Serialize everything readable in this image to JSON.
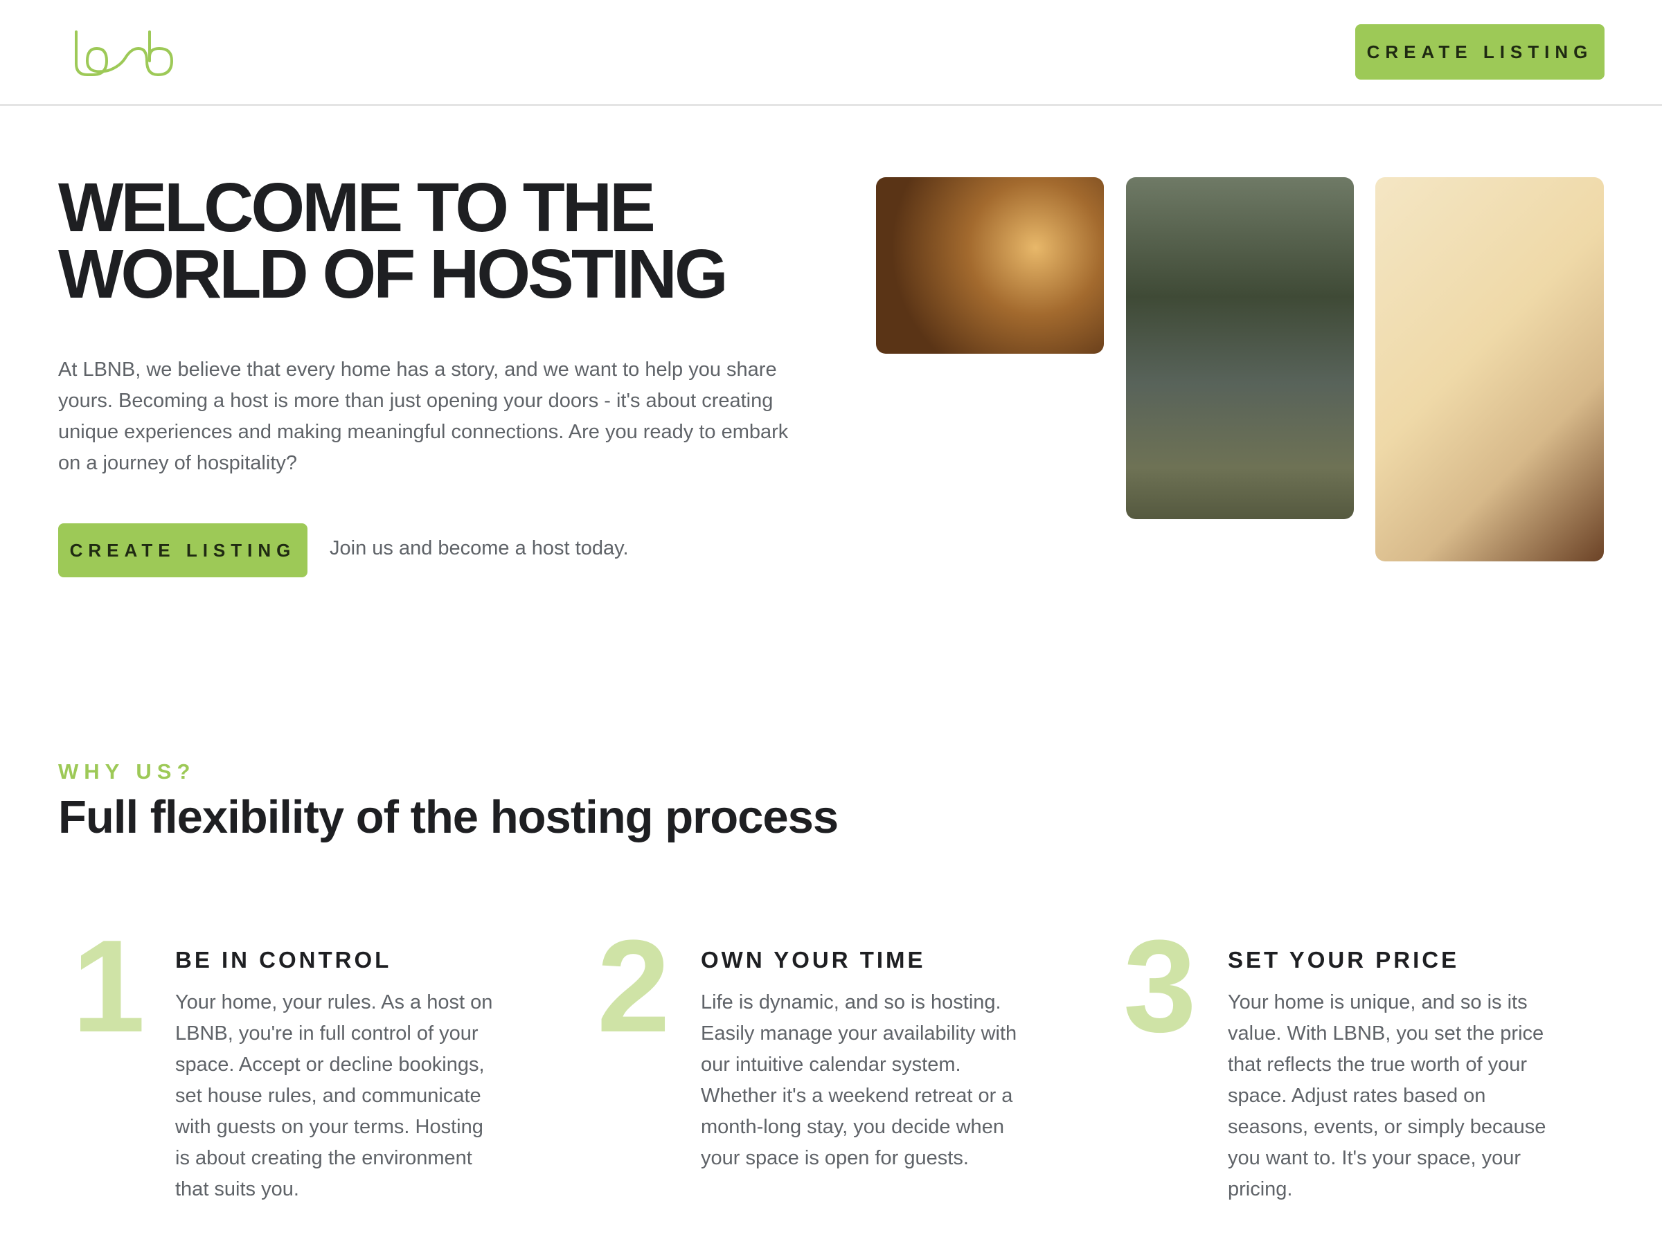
{
  "header": {
    "logo_text": "lbnb",
    "create_listing_label": "CREATE LISTING"
  },
  "hero": {
    "title_line1": "WELCOME TO THE",
    "title_line2": "WORLD OF HOSTING",
    "intro": "At LBNB, we believe that every home has a story, and we want to help you share yours. Becoming a host is more than just opening your doors - it's about creating unique experiences and making meaningful connections. Are you ready to embark on a journey of hospitality?",
    "cta_label": "CREATE LISTING",
    "cta_note": "Join us and become a host today."
  },
  "why": {
    "eyebrow": "WHY US?",
    "title": "Full flexibility of the hosting process",
    "features": [
      {
        "number": "1",
        "title": "BE IN CONTROL",
        "text": "Your home, your rules. As a host on LBNB, you're in full control of your space. Accept or decline bookings, set house rules, and communicate with guests on your terms. Hosting is about creating the environment that suits you."
      },
      {
        "number": "2",
        "title": "OWN YOUR TIME",
        "text": "Life is dynamic, and so is hosting. Easily manage your availability with our intuitive calendar system. Whether it's a weekend retreat or a month-long stay, you decide when your space is open for guests."
      },
      {
        "number": "3",
        "title": "SET YOUR PRICE",
        "text": "Your home is unique, and so is its value. With LBNB, you set the price that reflects the true worth of your space. Adjust rates based on seasons, events, or simply because you want to. It's your space, your pricing."
      }
    ]
  },
  "colors": {
    "accent": "#9dc957",
    "number": "#cfe3a6",
    "heading": "#1e1f22",
    "body": "#5f6368"
  }
}
